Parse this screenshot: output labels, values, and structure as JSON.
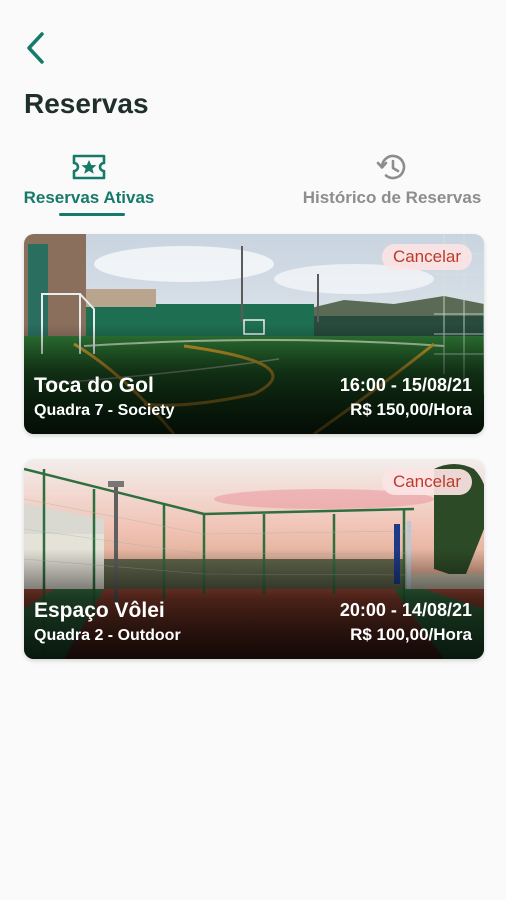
{
  "header": {
    "title": "Reservas",
    "back_icon": "chevron-left-icon"
  },
  "tabs": [
    {
      "label": "Reservas Ativas",
      "icon": "ticket-star-icon",
      "active": true
    },
    {
      "label": "Histórico de Reservas",
      "icon": "history-icon",
      "active": false
    }
  ],
  "reservations": [
    {
      "name": "Toca do Gol",
      "court": "Quadra 7 - Society",
      "datetime": "16:00 - 15/08/21",
      "price": "R$ 150,00/Hora",
      "cancel_label": "Cancelar",
      "image": "soccer-field-photo"
    },
    {
      "name": "Espaço Vôlei",
      "court": "Quadra 2 - Outdoor",
      "datetime": "20:00 - 14/08/21",
      "price": "R$ 100,00/Hora",
      "cancel_label": "Cancelar",
      "image": "volleyball-court-photo"
    }
  ],
  "colors": {
    "accent": "#167a6b",
    "inactive": "#8d8d8d",
    "cancel_text": "#c0392b",
    "cancel_bg": "#fce4e4",
    "background": "#fafafa"
  }
}
